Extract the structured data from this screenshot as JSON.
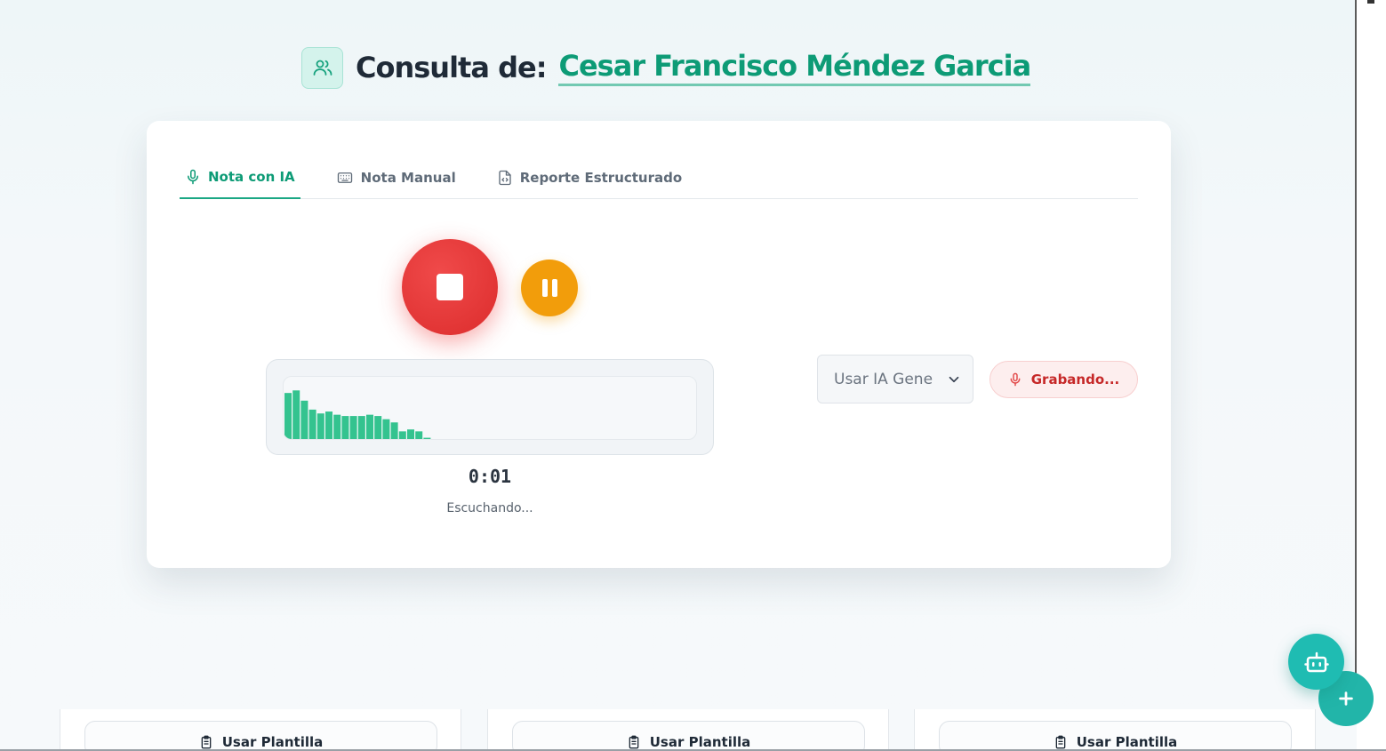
{
  "header": {
    "label": "Consulta de:",
    "patient_name": "Cesar Francisco Méndez Garcia",
    "icon": "users-icon"
  },
  "tabs": [
    {
      "label": "Nota con IA",
      "icon": "microphone-icon",
      "active": true
    },
    {
      "label": "Nota Manual",
      "icon": "keyboard-icon",
      "active": false
    },
    {
      "label": "Reporte Estructurado",
      "icon": "file-code-icon",
      "active": false
    }
  ],
  "recorder": {
    "timer": "0:01",
    "status": "Escuchando...",
    "waveform_levels": [
      0.72,
      0.76,
      0.6,
      0.46,
      0.4,
      0.43,
      0.38,
      0.36,
      0.36,
      0.36,
      0.38,
      0.36,
      0.31,
      0.26,
      0.12,
      0.15,
      0.12,
      0.02
    ]
  },
  "model_select": {
    "value": "Usar IA Gene"
  },
  "record_button": {
    "label": "Grabando..."
  },
  "templates": [
    {
      "label": "Usar Plantilla"
    },
    {
      "label": "Usar Plantilla"
    },
    {
      "label": "Usar Plantilla"
    }
  ],
  "colors": {
    "accent": "#0d9b76",
    "stop": "#e53935",
    "pause": "#f29d0b",
    "recording_text": "#c62828",
    "wave": "#34c38f",
    "fab": "#1fbcb2"
  }
}
